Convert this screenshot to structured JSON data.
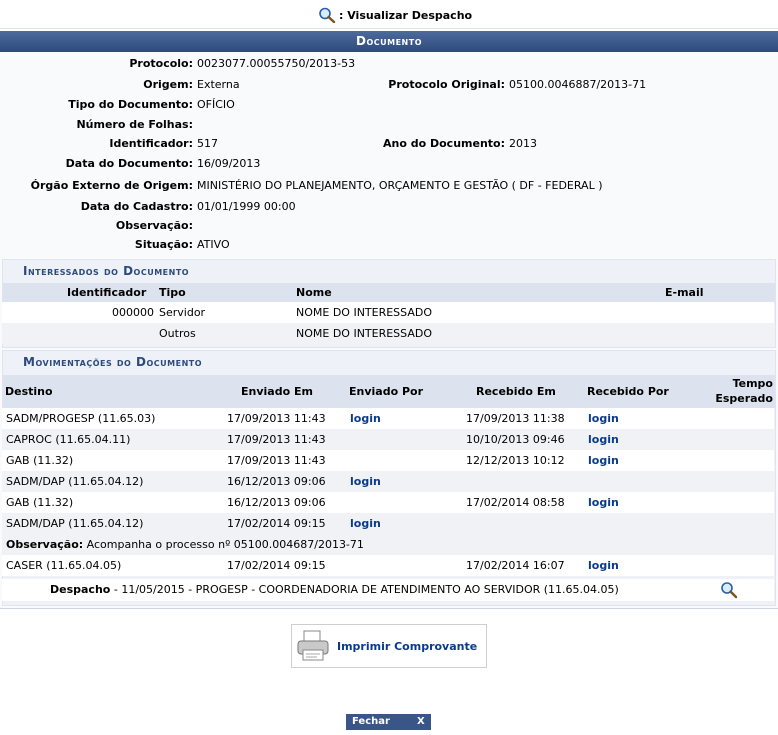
{
  "header": {
    "title": ": Visualizar Despacho"
  },
  "section_title": "Documento",
  "fields": {
    "protocolo": {
      "label": "Protocolo:",
      "value": "0023077.00055750/2013-53"
    },
    "origem": {
      "label": "Origem:",
      "value": "Externa"
    },
    "protocolo_original": {
      "label": "Protocolo Original:",
      "value": "05100.0046887/2013-71"
    },
    "tipo": {
      "label": "Tipo do Documento:",
      "value": "OFÍCIO"
    },
    "folhas": {
      "label": "Número de Folhas:",
      "value": ""
    },
    "identificador": {
      "label": "Identificador:",
      "value": "517"
    },
    "ano": {
      "label": "Ano do Documento:",
      "value": "2013"
    },
    "data_doc": {
      "label": "Data do Documento:",
      "value": "16/09/2013"
    },
    "orgao": {
      "label": "Órgão Externo de Origem:",
      "value": "MINISTÉRIO DO PLANEJAMENTO, ORÇAMENTO E GESTÃO ( DF - FEDERAL )"
    },
    "data_cadastro": {
      "label": "Data do Cadastro:",
      "value": "01/01/1999 00:00"
    },
    "observacao": {
      "label": "Observação:",
      "value": ""
    },
    "situacao": {
      "label": "Situação:",
      "value": "ATIVO"
    }
  },
  "interessados": {
    "title": "Interessados do Documento",
    "headers": {
      "identificador": "Identificador",
      "tipo": "Tipo",
      "nome": "Nome",
      "email": "E-mail"
    },
    "rows": [
      {
        "identificador": "000000",
        "tipo": "Servidor",
        "nome": "NOME DO INTERESSADO",
        "email": ""
      },
      {
        "identificador": "",
        "tipo": "Outros",
        "nome": "NOME DO INTERESSADO",
        "email": ""
      }
    ]
  },
  "movimentacoes": {
    "title": "Movimentações do Documento",
    "headers": {
      "destino": "Destino",
      "enviado_em": "Enviado Em",
      "enviado_por": "Enviado Por",
      "recebido_em": "Recebido Em",
      "recebido_por": "Recebido Por",
      "tempo_1": "Tempo",
      "tempo_2": "Esperado"
    },
    "rows": [
      {
        "destino": "SADM/PROGESP (11.65.03)",
        "enviado_em": "17/09/2013 11:43",
        "enviado_por": "login",
        "recebido_em": "17/09/2013 11:38",
        "recebido_por": "login"
      },
      {
        "destino": "CAPROC (11.65.04.11)",
        "enviado_em": "17/09/2013 11:43",
        "enviado_por": "",
        "recebido_em": "10/10/2013 09:46",
        "recebido_por": "login"
      },
      {
        "destino": "GAB (11.32)",
        "enviado_em": "17/09/2013 11:43",
        "enviado_por": "",
        "recebido_em": "12/12/2013 10:12",
        "recebido_por": "login"
      },
      {
        "destino": "SADM/DAP (11.65.04.12)",
        "enviado_em": "16/12/2013 09:06",
        "enviado_por": "login",
        "recebido_em": "",
        "recebido_por": ""
      },
      {
        "destino": "GAB (11.32)",
        "enviado_em": "16/12/2013 09:06",
        "enviado_por": "",
        "recebido_em": "17/02/2014 08:58",
        "recebido_por": "login"
      },
      {
        "destino": "SADM/DAP (11.65.04.12)",
        "enviado_em": "17/02/2014 09:15",
        "enviado_por": "login",
        "recebido_em": "",
        "recebido_por": ""
      }
    ],
    "observacao_label": "Observação:",
    "observacao_text": " Acompanha o processo nº 05100.004687/2013-71",
    "last_row": {
      "destino": "CASER (11.65.04.05)",
      "enviado_em": "17/02/2014 09:15",
      "enviado_por": "",
      "recebido_em": "17/02/2014 16:07",
      "recebido_por": "login"
    },
    "despacho_label": "Despacho",
    "despacho_text": " - 11/05/2015 - PROGESP - COORDENADORIA DE ATENDIMENTO AO SERVIDOR (11.65.04.05)"
  },
  "buttons": {
    "print": "Imprimir Comprovante",
    "close": "Fechar",
    "close_x": "X"
  }
}
